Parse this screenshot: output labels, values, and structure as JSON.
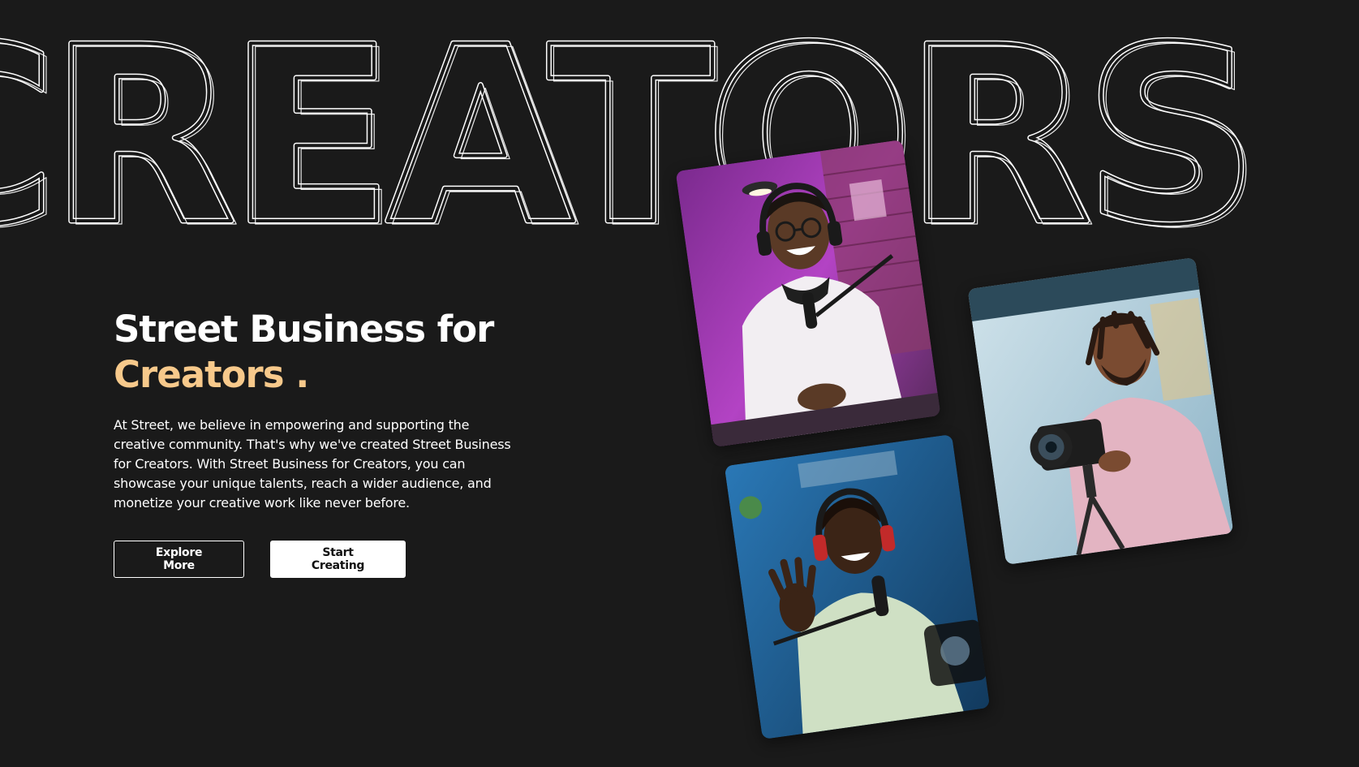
{
  "background": {
    "word": "CREATORS",
    "color": "#1a1a1a",
    "outline_color": "#ffffff"
  },
  "hero": {
    "title_line1": "Street Business for",
    "title_accent": "Creators",
    "title_punct": ".",
    "accent_color": "#f7c98b",
    "description": "At Street, we believe in empowering and supporting the creative community. That's why we've created Street Business for Creators. With Street Business for Creators, you can showcase your unique talents, reach a wider audience, and monetize your creative work like never before."
  },
  "actions": {
    "explore_label": "Explore More",
    "start_label": "Start Creating"
  },
  "photos": [
    {
      "subject": "podcaster-white-hoodie",
      "tone": "#a23fb5"
    },
    {
      "subject": "photographer-pink-hoodie",
      "tone": "#9fc4d6"
    },
    {
      "subject": "streamer-waving",
      "tone": "#1f5f95"
    }
  ]
}
